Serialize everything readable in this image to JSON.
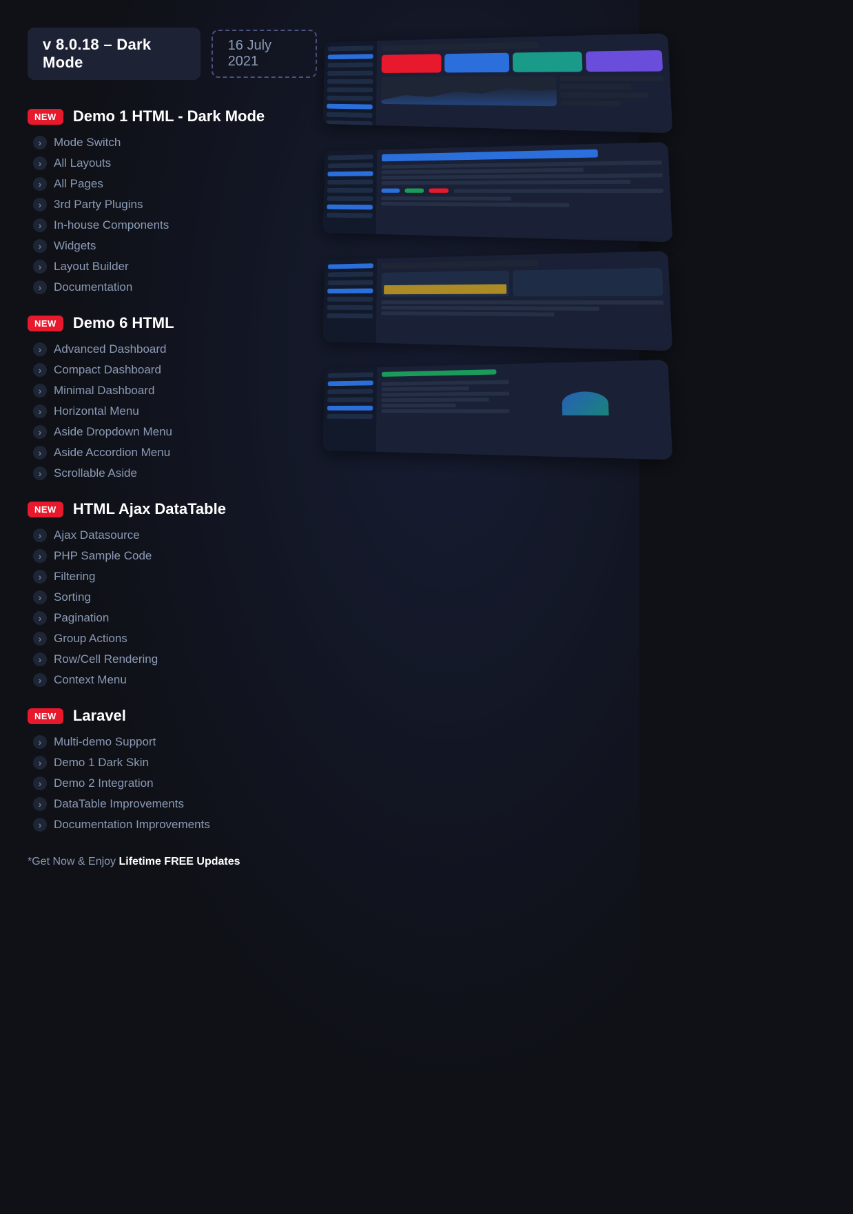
{
  "header": {
    "version": "v 8.0.18 – Dark Mode",
    "date": "16 July 2021"
  },
  "sections": [
    {
      "id": "demo1",
      "badge": "New",
      "title": "Demo 1 HTML - Dark Mode",
      "items": [
        "Mode Switch",
        "All Layouts",
        "All Pages",
        "3rd Party Plugins",
        "In-house Components",
        "Widgets",
        "Layout Builder",
        "Documentation"
      ]
    },
    {
      "id": "demo6",
      "badge": "New",
      "title": "Demo 6 HTML",
      "items": [
        "Advanced Dashboard",
        "Compact Dashboard",
        "Minimal Dashboard",
        "Horizontal Menu",
        "Aside Dropdown Menu",
        "Aside Accordion Menu",
        "Scrollable Aside"
      ]
    },
    {
      "id": "datatable",
      "badge": "New",
      "title": "HTML Ajax DataTable",
      "items": [
        "Ajax Datasource",
        "PHP Sample Code",
        "Filtering",
        "Sorting",
        "Pagination",
        "Group Actions",
        "Row/Cell Rendering",
        "Context Menu"
      ]
    },
    {
      "id": "laravel",
      "badge": "New",
      "title": "Laravel",
      "items": [
        "Multi-demo Support",
        "Demo 1 Dark Skin",
        "Demo 2 Integration",
        "DataTable Improvements",
        "Documentation Improvements"
      ]
    }
  ],
  "footer": {
    "text": "*Get Now & Enjoy ",
    "highlight": "Lifetime FREE Updates"
  }
}
